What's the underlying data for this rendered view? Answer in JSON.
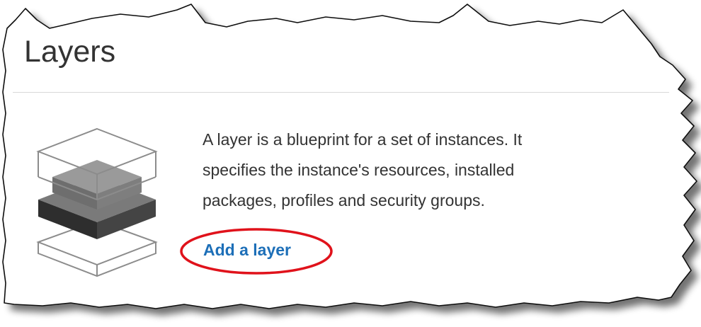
{
  "header": {
    "title": "Layers"
  },
  "empty_state": {
    "illustration_icon": "stacked-layers-icon",
    "description_lines": [
      "A layer is a blueprint for a set of instances. It",
      "specifies the instance's resources, installed",
      "packages, profiles and security groups."
    ],
    "add_layer_label": "Add a layer"
  },
  "colors": {
    "title_text": "#333333",
    "body_text": "#333333",
    "link": "#1d6fb8",
    "highlight_ellipse": "#e0121b",
    "divider": "#d9d9d9"
  }
}
